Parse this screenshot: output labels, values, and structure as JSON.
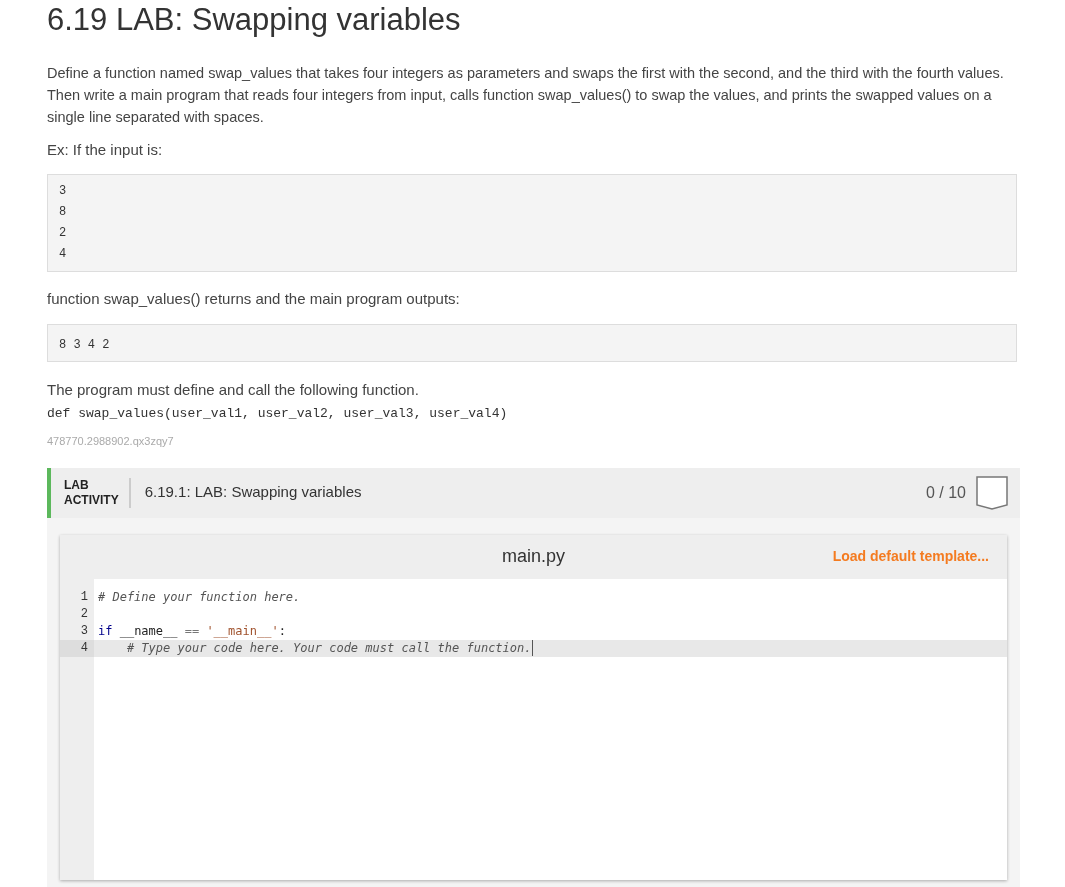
{
  "title": "6.19 LAB: Swapping variables",
  "description": "Define a function named swap_values that takes four integers as parameters and swaps the first with the second, and the third with the fourth values. Then write a main program that reads four integers from input, calls function swap_values() to swap the values, and prints the swapped values on a single line separated with spaces.",
  "example_intro": "Ex: If the input is:",
  "example_input": [
    "3",
    "8",
    "2",
    "4"
  ],
  "output_intro": "function swap_values() returns and the main program outputs:",
  "example_output": "8 3 4 2",
  "requirement": "The program must define and call the following function.",
  "signature": "def swap_values(user_val1, user_val2, user_val3, user_val4)",
  "activity_id": "478770.2988902.qx3zqy7",
  "lab": {
    "label_top": "LAB",
    "label_bottom": "ACTIVITY",
    "title": "6.19.1: LAB: Swapping variables",
    "score": "0 / 10"
  },
  "editor": {
    "filename": "main.py",
    "template_link": "Load default template...",
    "lines": [
      {
        "number": "1",
        "current": false,
        "tokens": [
          {
            "kind": "comment",
            "text": "# Define your function here."
          }
        ]
      },
      {
        "number": "2",
        "current": false
      },
      {
        "number": "3",
        "current": false,
        "tokens": [
          {
            "kind": "keyword",
            "text": "if"
          },
          {
            "kind": "plain",
            "text": " __name__ "
          },
          {
            "kind": "operator",
            "text": "=="
          },
          {
            "kind": "string",
            "text": " '__main__'"
          },
          {
            "kind": "plain",
            "text": ":"
          }
        ]
      },
      {
        "number": "4",
        "current": true,
        "tokens": [
          {
            "kind": "comment",
            "text": "    # Type your code here. Your code must call the function."
          }
        ]
      }
    ]
  }
}
